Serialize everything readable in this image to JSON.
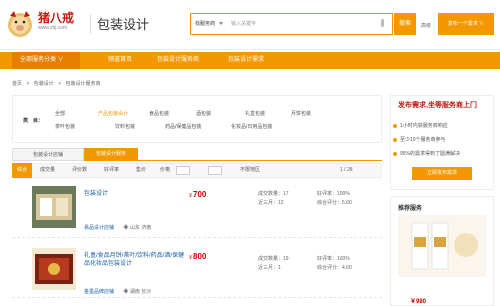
{
  "header": {
    "logo_text": "猪八戒",
    "logo_sub": "www.zbj.com",
    "site_title": "包装设计",
    "search_category": "找服务商",
    "search_placeholder": "输入关键字",
    "search_button": "搜索",
    "advanced": "高级",
    "post_button": "发布一个需求 ∨"
  },
  "nav": {
    "all_label": "全部服务分类 ∨",
    "items": [
      "频道首页",
      "包装设计服务商",
      "包装设计需求"
    ]
  },
  "breadcrumb": [
    "首页",
    ">",
    "包装设计",
    ">",
    "包装设计服务商"
  ],
  "filter": {
    "label": "类　目：",
    "row1": [
      "全部",
      "产品包装设计",
      "食品包装",
      "酒包装",
      "礼盒包装",
      "月饼包装"
    ],
    "row2": [
      "茶叶包装",
      "饮料包装",
      "药品/保健品包装",
      "化妆品/日用品包装"
    ]
  },
  "tabs": [
    "包装设计店铺",
    "包装设计服务"
  ],
  "sort": {
    "items": [
      "综合",
      "成交量",
      "评价数",
      "好评率",
      "售价",
      "价格"
    ],
    "checkbox_label": "不限地区",
    "pager": "1 / 28"
  },
  "items": [
    {
      "title": "包装设计",
      "price": "700",
      "currency": "￥",
      "sales": "成交数量：17",
      "recent": "近三月：12",
      "rating": "好评率：100%",
      "score": "综合评分：5.00",
      "shop_label": "易品设计店铺",
      "location": "山东 济南"
    },
    {
      "title": "礼盒/食品月饼/茶叶/饮料/药品/酒/保健品化妆品包装设计",
      "price": "800",
      "currency": "￥",
      "sales": "成交数量：19",
      "recent": "近三月：1",
      "rating": "好评率：100%",
      "score": "综合评分：4.00",
      "shop_label": "金墨品牌店铺",
      "location": "湖南 长沙"
    }
  ],
  "sidebar": {
    "title": "发布需求,坐等服务商上门",
    "lines": [
      "1小时内获服务商响应",
      "至少10个服务商参与",
      "95%的需求得到了圆满解决"
    ],
    "button": "立即发布需求"
  },
  "recommend": {
    "title": "推荐服务",
    "price": "￥980"
  },
  "colors": {
    "accent": "#f39800",
    "brand_red": "#c01a12",
    "link": "#1a5fa6"
  }
}
